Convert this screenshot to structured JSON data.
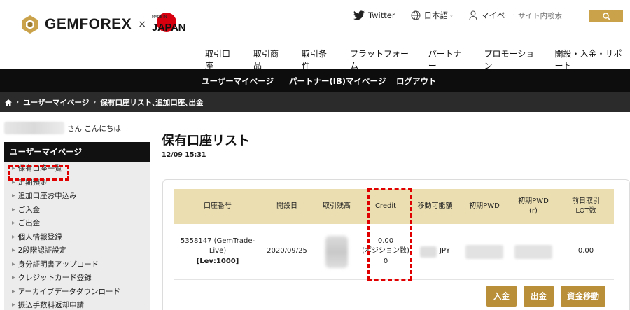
{
  "header": {
    "brand": "GEMFOREX",
    "times": "×",
    "mij_small": "MADE IN",
    "mij_big": "JAPAN",
    "twitter": "Twitter",
    "language": "日本語",
    "mypage": "マイページ",
    "search_placeholder": "サイト内検索"
  },
  "main_nav": [
    "取引口座",
    "取引商品",
    "取引条件",
    "プラットフォーム",
    "パートナー",
    "プロモーション",
    "開設・入金・サポート"
  ],
  "sub_nav": {
    "user_page": "ユーザーマイページ",
    "partner_page": "パートナー(IB)マイページ",
    "logout": "ログアウト"
  },
  "breadcrumb": {
    "sep": "›",
    "item1": "ユーザーマイページ",
    "item2": "保有口座リスト､追加口座､出金"
  },
  "sidebar": {
    "greeting": "さん こんにちは",
    "heading": "ユーザーマイページ",
    "items": [
      "保有口座一覧",
      "定期預金",
      "追加口座お申込み",
      "ご入金",
      "ご出金",
      "個人情報登録",
      "2段階認証設定",
      "身分証明書アップロード",
      "クレジットカード登録",
      "アーカイブデータダウンロード",
      "振込手数料返却申請"
    ]
  },
  "content": {
    "title": "保有口座リスト",
    "time": "12/09 15:31"
  },
  "table": {
    "headers": [
      "口座番号",
      "開設日",
      "取引残高",
      "Credit",
      "移動可能額",
      "初期PWD",
      "初期PWD\n(r)",
      "前日取引\nLOT数"
    ],
    "row": {
      "account": "5358147 (GemTrade-Live)",
      "leverage": "[Lev:1000]",
      "opened": "2020/09/25",
      "credit": "0.00\n(ポジション数)\n0",
      "currency": "JPY",
      "lots": "0.00"
    }
  },
  "buttons": {
    "deposit": "入金",
    "withdraw": "出金",
    "transfer": "資金移動"
  },
  "colors": {
    "gold": "#c9a24a",
    "button_gold": "#b98f3a",
    "table_header": "#ebdfb1",
    "highlight_red": "#e00000"
  }
}
